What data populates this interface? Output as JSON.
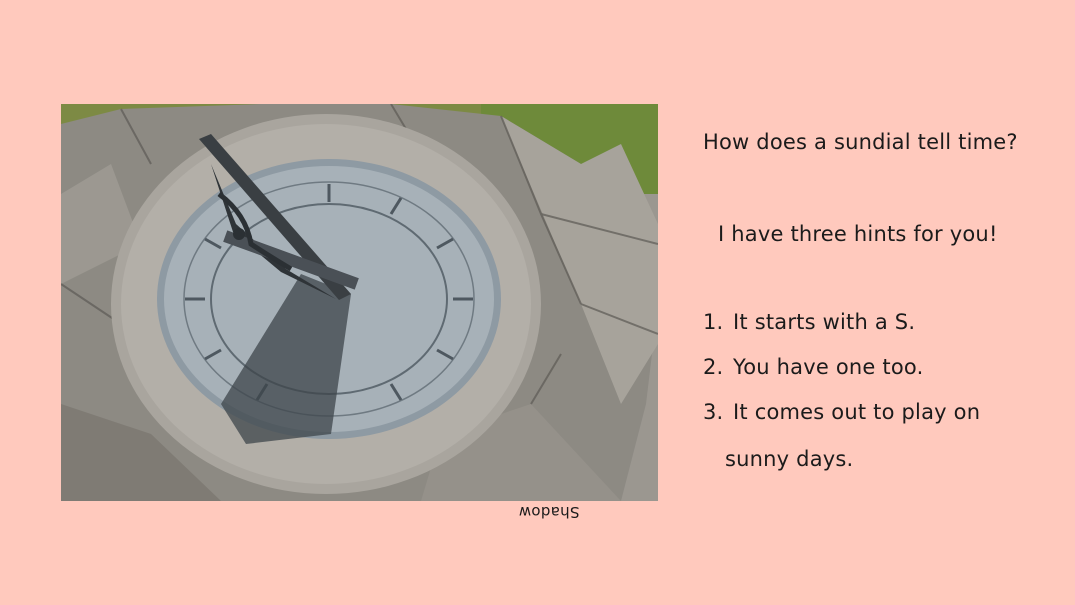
{
  "photo": {
    "flipped_caption": "Shadow"
  },
  "question": "How does a sundial tell time?",
  "hints_intro": "I have three hints for you!",
  "hints": [
    {
      "num": "1.",
      "text": "It starts with a S."
    },
    {
      "num": "2.",
      "text": "You have one too."
    },
    {
      "num": "3.",
      "text": "It comes out to play on",
      "continuation": "sunny days."
    }
  ],
  "colors": {
    "background": "#ffc9bd",
    "text": "#1b1b1b"
  }
}
